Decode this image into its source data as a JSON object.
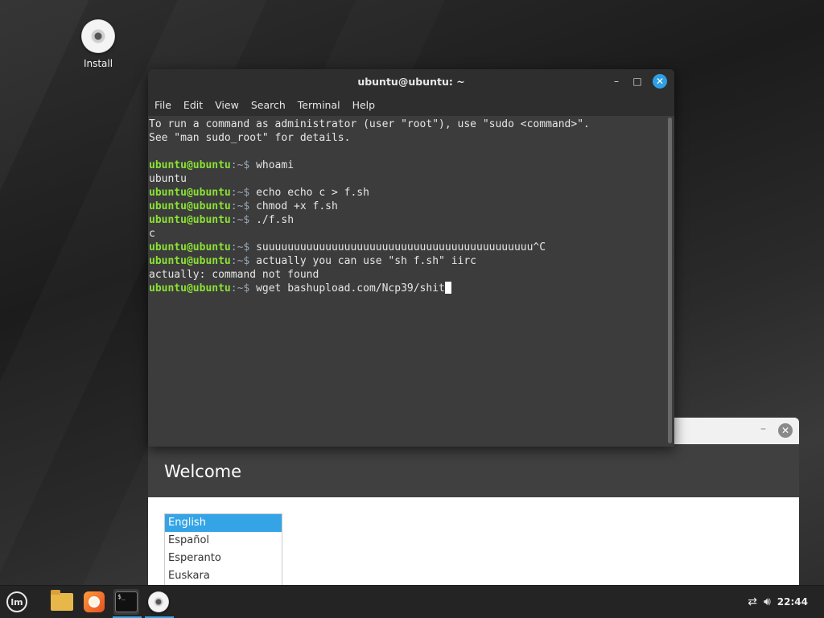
{
  "desktop": {
    "install_label": "Install"
  },
  "terminal": {
    "title": "ubuntu@ubuntu: ~",
    "minimize_glyph": "–",
    "maximize_glyph": "□",
    "close_glyph": "✕",
    "menu": [
      "File",
      "Edit",
      "View",
      "Search",
      "Terminal",
      "Help"
    ],
    "prompt_user": "ubuntu@ubuntu",
    "prompt_sep": ":~$ ",
    "lines": [
      {
        "type": "out",
        "text": "To run a command as administrator (user \"root\"), use \"sudo <command>\"."
      },
      {
        "type": "out",
        "text": "See \"man sudo_root\" for details."
      },
      {
        "type": "out",
        "text": ""
      },
      {
        "type": "cmd",
        "text": "whoami"
      },
      {
        "type": "out",
        "text": "ubuntu"
      },
      {
        "type": "cmd",
        "text": "echo echo c > f.sh"
      },
      {
        "type": "cmd",
        "text": "chmod +x f.sh"
      },
      {
        "type": "cmd",
        "text": "./f.sh"
      },
      {
        "type": "out",
        "text": "c"
      },
      {
        "type": "cmd",
        "text": "suuuuuuuuuuuuuuuuuuuuuuuuuuuuuuuuuuuuuuuuuuu^C"
      },
      {
        "type": "cmd",
        "text": "actually you can use \"sh f.sh\" iirc"
      },
      {
        "type": "out",
        "text": "actually: command not found"
      },
      {
        "type": "cmd",
        "text": "wget bashupload.com/Ncp39/shit",
        "cursor": true
      }
    ]
  },
  "welcome": {
    "title": "Welcome",
    "minimize_glyph": "–",
    "close_glyph": "✕",
    "languages": [
      "English",
      "Español",
      "Esperanto",
      "Euskara"
    ],
    "selected": "English"
  },
  "taskbar": {
    "menu_logo_text": "lm",
    "terminal_icon_text": "$_",
    "clock": "22:44"
  },
  "colors": {
    "prompt_green": "#8ae234",
    "accent_blue": "#35a4e6",
    "close_blue": "#2f9fe4"
  }
}
